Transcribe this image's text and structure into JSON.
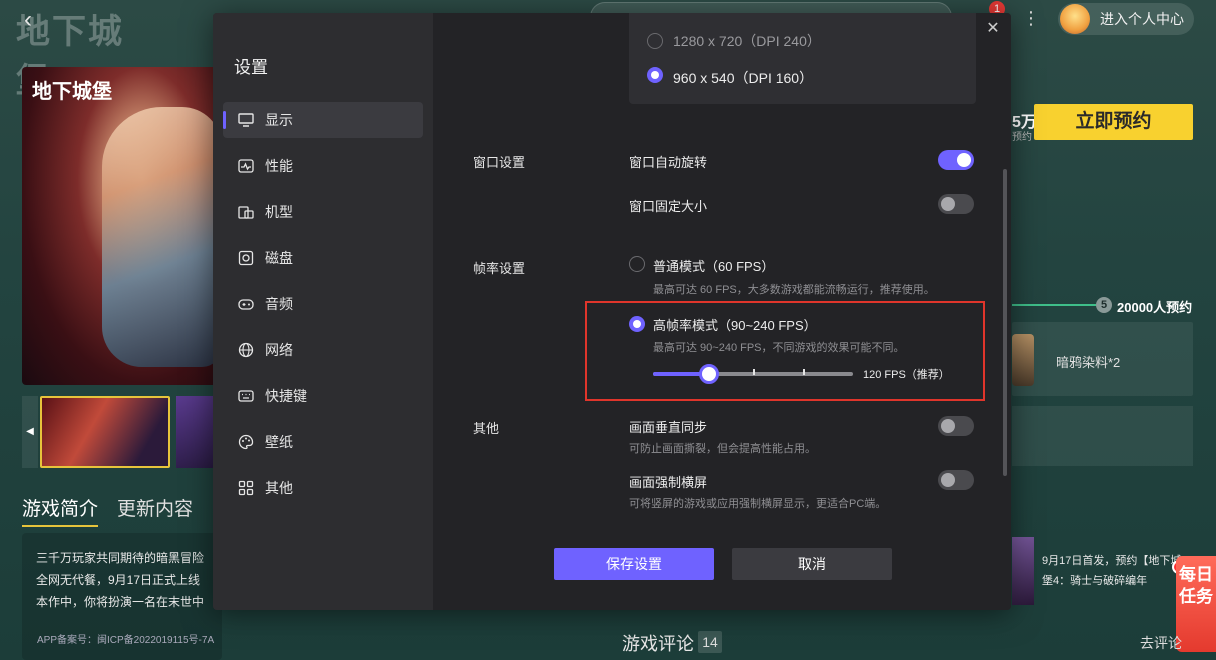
{
  "background": {
    "top_logo": "地下城堡",
    "notification_count": "1",
    "user_center_label": "进入个人中心",
    "main_art_logo": "地下城堡",
    "tabs": [
      {
        "label": "游戏简介"
      },
      {
        "label": "更新内容"
      }
    ],
    "intro_lines": [
      "三千万玩家共同期待的暗黑冒险",
      "全网无代餐，9月17日正式上线",
      "本作中，你将扮演一名在末世中"
    ],
    "icp": "APP备案号：闽ICP备2022019115号-7A",
    "stat_num": "5万",
    "stat_sub": "预约",
    "reserve_button": "立即预约",
    "progress_step": "5",
    "progress_label": "20000人预约",
    "reward_label": "暗鸦染料*2",
    "news_text": "9月17日首发，预约【地下城堡4：骑士与破碎编年",
    "daily_task": "每日任务",
    "review_title": "游戏评论",
    "review_count": "14",
    "review_link": "去评论"
  },
  "settings": {
    "title": "设置",
    "nav": [
      {
        "label": "显示",
        "icon": "monitor-icon"
      },
      {
        "label": "性能",
        "icon": "pulse-icon"
      },
      {
        "label": "机型",
        "icon": "device-icon"
      },
      {
        "label": "磁盘",
        "icon": "disk-icon"
      },
      {
        "label": "音频",
        "icon": "gamepad-icon"
      },
      {
        "label": "网络",
        "icon": "globe-icon"
      },
      {
        "label": "快捷键",
        "icon": "keyboard-icon"
      },
      {
        "label": "壁纸",
        "icon": "palette-icon"
      },
      {
        "label": "其他",
        "icon": "grid-icon"
      }
    ],
    "active_nav": "显示",
    "resolutions": [
      {
        "label": "1280 x 720（DPI 240）",
        "selected": false
      },
      {
        "label": "960 x 540（DPI 160）",
        "selected": true
      }
    ],
    "window_section": {
      "title": "窗口设置",
      "auto_rotate": {
        "label": "窗口自动旋转",
        "on": true
      },
      "fixed_size": {
        "label": "窗口固定大小",
        "on": false
      }
    },
    "fps_section": {
      "title": "帧率设置",
      "normal": {
        "label": "普通模式（60 FPS）",
        "desc": "最高可达 60 FPS，大多数游戏都能流畅运行，推荐使用。",
        "selected": false
      },
      "high": {
        "label": "高帧率模式（90~240 FPS）",
        "desc": "最高可达 90~240 FPS，不同游戏的效果可能不同。",
        "selected": true
      },
      "slider_value_label": "120 FPS（推荐）",
      "slider_fraction": 0.28
    },
    "other_section": {
      "title": "其他",
      "vsync": {
        "label": "画面垂直同步",
        "desc": "可防止画面撕裂，但会提高性能占用。",
        "on": false
      },
      "force_landscape": {
        "label": "画面强制横屏",
        "desc": "可将竖屏的游戏或应用强制横屏显示，更适合PC端。",
        "on": false
      }
    },
    "save_button": "保存设置",
    "cancel_button": "取消",
    "colors": {
      "accent": "#6f62ff",
      "highlight": "#e0352b"
    }
  }
}
